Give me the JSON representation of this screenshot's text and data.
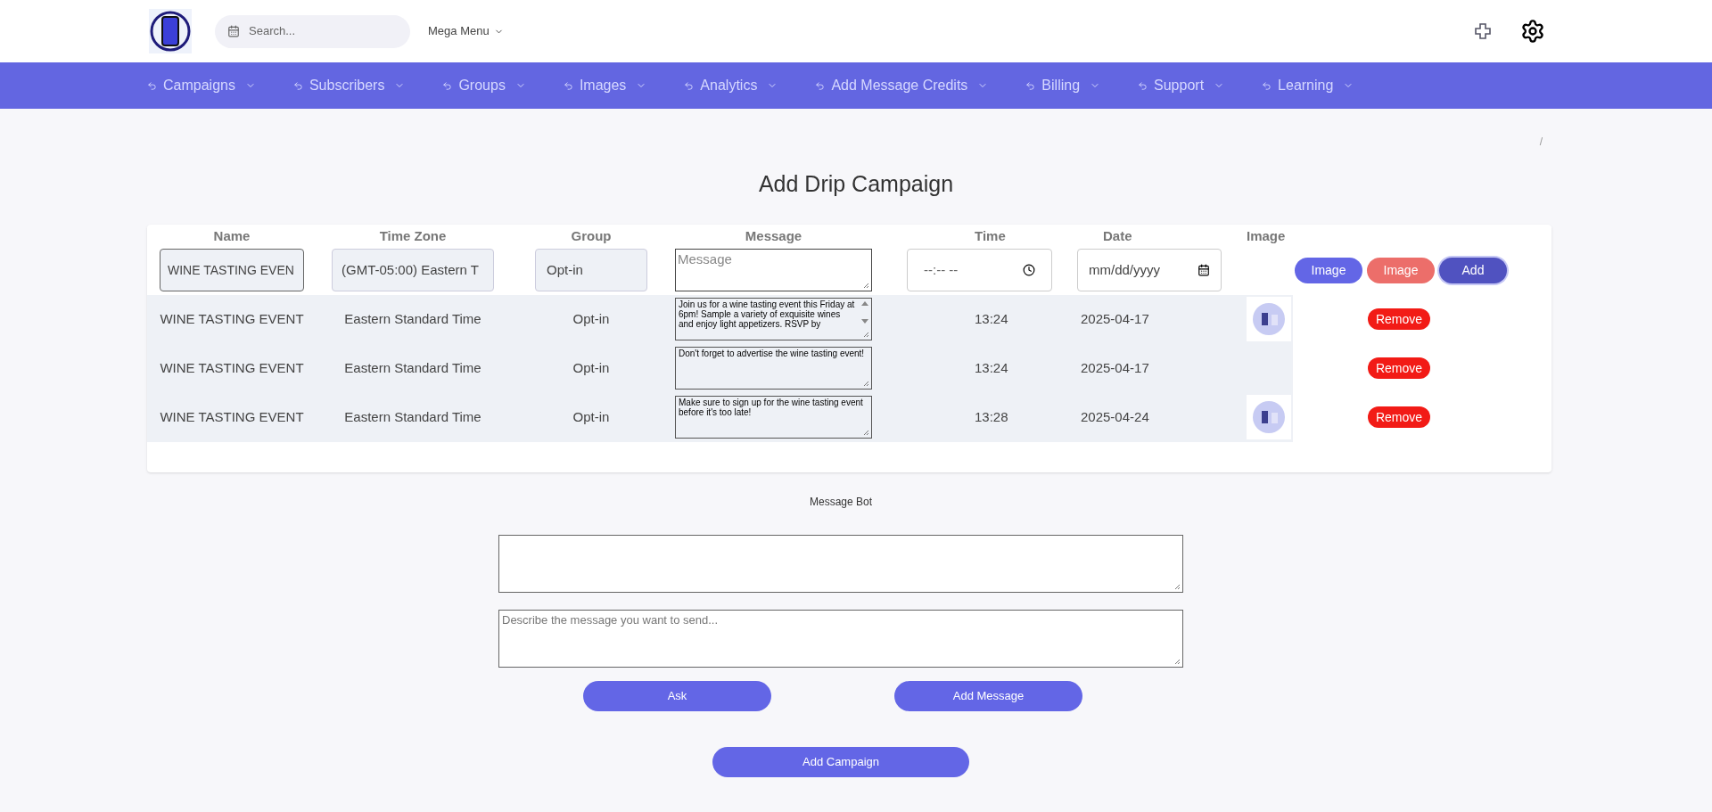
{
  "header": {
    "search": {
      "placeholder": "Search..."
    },
    "mega_menu": "Mega Menu"
  },
  "nav": [
    "Campaigns",
    "Subscribers",
    "Groups",
    "Images",
    "Analytics",
    "Add Message Credits",
    "Billing",
    "Support",
    "Learning"
  ],
  "breadcrumb": "/",
  "title": "Add Drip Campaign",
  "table": {
    "columns": [
      "Name",
      "Time Zone",
      "Group",
      "Message",
      "Time",
      "Date",
      "Image"
    ],
    "input_row": {
      "name": "WINE TASTING EVEN",
      "time_zone": "(GMT-05:00) Eastern T",
      "group": "Opt-in",
      "message_placeholder": "Message",
      "time": "--:-- --",
      "date": "mm/dd/yyyy",
      "buttons": [
        {
          "label": "Image",
          "color": "#6366e6"
        },
        {
          "label": "Image",
          "color": "#ec6e6a"
        },
        {
          "label": "Add",
          "color": "#5052c0"
        }
      ]
    },
    "rows": [
      {
        "name": "WINE TASTING EVENT",
        "time_zone": "Eastern Standard Time",
        "group": "Opt-in",
        "message": "Join us for a wine tasting event this Friday at 6pm! Sample a variety of exquisite wines and enjoy light appetizers. RSVP by",
        "scrollable": true,
        "time": "13:24",
        "date": "2025-04-17",
        "has_image": true,
        "action": "Remove"
      },
      {
        "name": "WINE TASTING EVENT",
        "time_zone": "Eastern Standard Time",
        "group": "Opt-in",
        "message": "Don't forget to advertise the wine tasting event!",
        "scrollable": false,
        "time": "13:24",
        "date": "2025-04-17",
        "has_image": false,
        "action": "Remove"
      },
      {
        "name": "WINE TASTING EVENT",
        "time_zone": "Eastern Standard Time",
        "group": "Opt-in",
        "message": "Make sure to sign up for the wine tasting event before it's too late!",
        "scrollable": false,
        "time": "13:28",
        "date": "2025-04-24",
        "has_image": true,
        "action": "Remove"
      }
    ]
  },
  "message_bot": {
    "label": "Message Bot",
    "prompt_placeholder": "Describe the message you want to send...",
    "buttons": [
      "Ask",
      "Add Message"
    ]
  },
  "submit": "Add Campaign"
}
